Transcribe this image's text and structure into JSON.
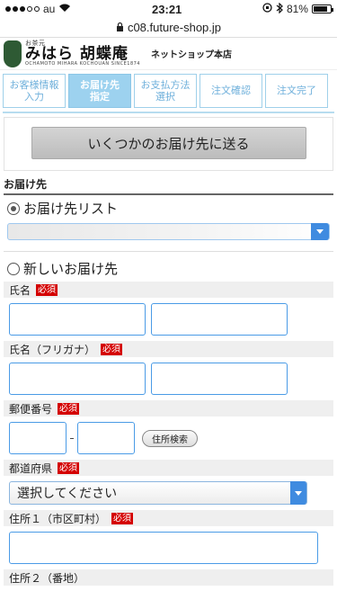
{
  "status_bar": {
    "carrier": "au",
    "time": "23:21",
    "battery": "81%",
    "battery_level": 0.81
  },
  "browser": {
    "url": "c08.future-shop.jp",
    "lock_icon": "lock-icon"
  },
  "header": {
    "brand_small": "お茶元",
    "brand_main": "みはら 胡蝶庵",
    "brand_romaji": "OCHAMOTO MIHARA KOCHOUAN SINCE1874",
    "shop_label": "ネットショップ本店"
  },
  "steps": [
    {
      "label": "お客様情報\n入力",
      "active": false
    },
    {
      "label": "お届け先\n指定",
      "active": true
    },
    {
      "label": "お支払方法\n選択",
      "active": false
    },
    {
      "label": "注文確認",
      "active": false
    },
    {
      "label": "注文完了",
      "active": false
    }
  ],
  "multi_delivery_button": "いくつかのお届け先に送る",
  "delivery": {
    "section_title": "お届け先",
    "list_option": "お届け先リスト",
    "new_option": "新しいお届け先",
    "required_badge": "必須",
    "fields": {
      "name": "氏名",
      "kana": "氏名（フリガナ）",
      "zip": "郵便番号",
      "zip_search": "住所検索",
      "pref": "都道府県",
      "pref_placeholder": "選択してください",
      "address1": "住所１（市区町村）",
      "address2": "住所２（番地）"
    }
  },
  "colors": {
    "accent_blue": "#3f8be0",
    "step_active": "#9dd2ef",
    "required_red": "#d40000"
  }
}
